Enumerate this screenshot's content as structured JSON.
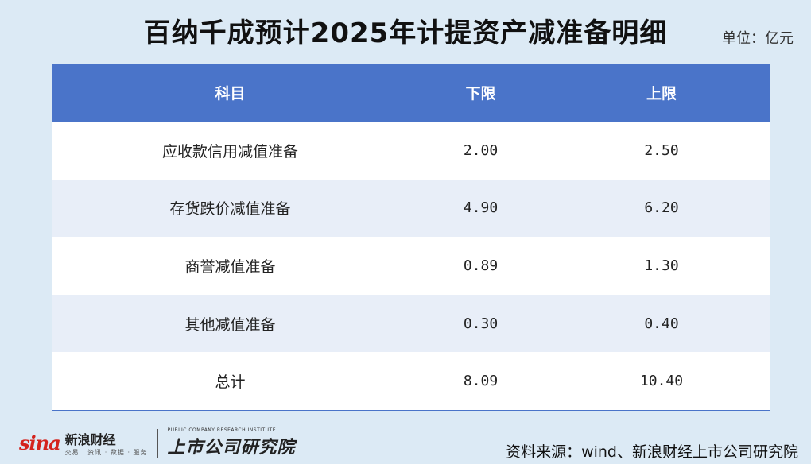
{
  "title": "百纳千成预计2025年计提资产减准备明细",
  "unit": "单位：亿元",
  "source": "资料来源：wind、新浪财经上市公司研究院",
  "logo": {
    "sina_mark": "sina",
    "sina_cn": "新浪财经",
    "sina_sub": "交易 · 资讯 · 数据 · 服务",
    "inst_en": "PUBLIC COMPANY RESEARCH INSTITUTE",
    "inst_cn": "上市公司研究院"
  },
  "chart_data": {
    "type": "table",
    "title": "百纳千成预计2025年计提资产减准备明细",
    "columns": [
      "科目",
      "下限",
      "上限"
    ],
    "rows": [
      {
        "item": "应收款信用减值准备",
        "low": "2.00",
        "high": "2.50"
      },
      {
        "item": "存货跌价减值准备",
        "low": "4.90",
        "high": "6.20"
      },
      {
        "item": "商誉减值准备",
        "low": "0.89",
        "high": "1.30"
      },
      {
        "item": "其他减值准备",
        "low": "0.30",
        "high": "0.40"
      },
      {
        "item": "总计",
        "low": "8.09",
        "high": "10.40"
      }
    ]
  }
}
